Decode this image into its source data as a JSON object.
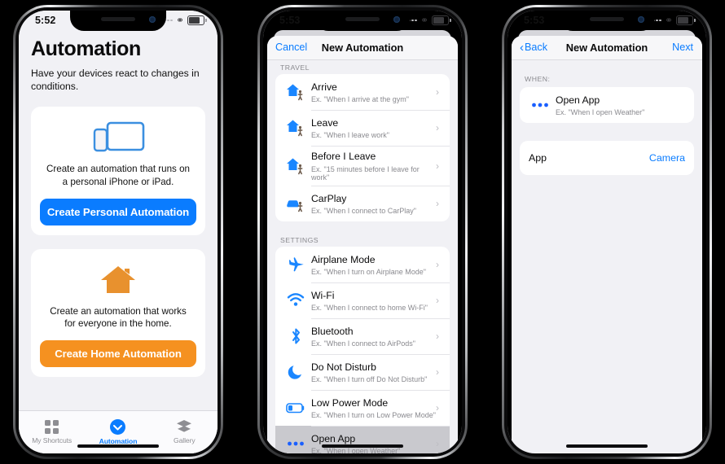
{
  "phones": [
    {
      "id": "phone-automation-home",
      "status": {
        "time": "5:52",
        "icons": [
          "signal-dots-icon",
          "link-icon",
          "battery-icon"
        ]
      },
      "screen1": {
        "title": "Automation",
        "subtitle": "Have your devices react to changes in conditions.",
        "cards": [
          {
            "icon": "ipad-iphone-icon",
            "text": "Create an automation that runs on a personal iPhone or iPad.",
            "button": "Create Personal Automation",
            "color": "#0a7cff"
          },
          {
            "icon": "house-icon",
            "text": "Create an automation that works for everyone in the home.",
            "button": "Create Home Automation",
            "color": "#f59120"
          }
        ],
        "tabs": [
          {
            "label": "My Shortcuts",
            "icon": "grid-icon",
            "active": false
          },
          {
            "label": "Automation",
            "icon": "automation-check-icon",
            "active": true
          },
          {
            "label": "Gallery",
            "icon": "layers-icon",
            "active": false
          }
        ]
      }
    },
    {
      "id": "phone-new-automation-list",
      "status": {
        "time": "5:53"
      },
      "nav": {
        "left": "Cancel",
        "title": "New Automation",
        "right": ""
      },
      "sections": [
        {
          "header": "TRAVEL",
          "rows": [
            {
              "icon": "house-walk-icon",
              "title": "Arrive",
              "sub": "Ex. \"When I arrive at the gym\"",
              "selected": false
            },
            {
              "icon": "house-walk-icon",
              "title": "Leave",
              "sub": "Ex. \"When I leave work\"",
              "selected": false
            },
            {
              "icon": "house-walk-icon",
              "title": "Before I Leave",
              "sub": "Ex. \"15 minutes before I leave for work\"",
              "selected": false
            },
            {
              "icon": "car-walk-icon",
              "title": "CarPlay",
              "sub": "Ex. \"When I connect to CarPlay\"",
              "selected": false
            }
          ]
        },
        {
          "header": "SETTINGS",
          "rows": [
            {
              "icon": "airplane-icon",
              "title": "Airplane Mode",
              "sub": "Ex. \"When I turn on Airplane Mode\"",
              "selected": false
            },
            {
              "icon": "wifi-icon",
              "title": "Wi-Fi",
              "sub": "Ex. \"When I connect to home Wi-Fi\"",
              "selected": false
            },
            {
              "icon": "bluetooth-icon",
              "title": "Bluetooth",
              "sub": "Ex. \"When I connect to AirPods\"",
              "selected": false
            },
            {
              "icon": "moon-icon",
              "title": "Do Not Disturb",
              "sub": "Ex. \"When I turn off Do Not Disturb\"",
              "selected": false
            },
            {
              "icon": "low-battery-icon",
              "title": "Low Power Mode",
              "sub": "Ex. \"When I turn on Low Power Mode\"",
              "selected": false
            }
          ]
        },
        {
          "header": "",
          "rows": [
            {
              "icon": "ellipsis-icon",
              "title": "Open App",
              "sub": "Ex. \"When I open Weather\"",
              "selected": true
            }
          ]
        }
      ]
    },
    {
      "id": "phone-new-automation-detail",
      "status": {
        "time": "5:53"
      },
      "nav": {
        "left": "Back",
        "title": "New Automation",
        "right": "Next"
      },
      "when_header": "WHEN:",
      "trigger": {
        "icon": "ellipsis-icon",
        "title": "Open App",
        "sub": "Ex. \"When I open Weather\""
      },
      "fields": [
        {
          "key": "App",
          "value": "Camera"
        }
      ]
    }
  ],
  "theme": {
    "accent_blue": "#0a7cff",
    "accent_orange": "#f59120",
    "bg_gray": "#f1f1f5",
    "card_white": "#ffffff",
    "selected_gray": "#c9c9ce",
    "muted_text": "#8a8a8f",
    "page_background": "#000000"
  }
}
